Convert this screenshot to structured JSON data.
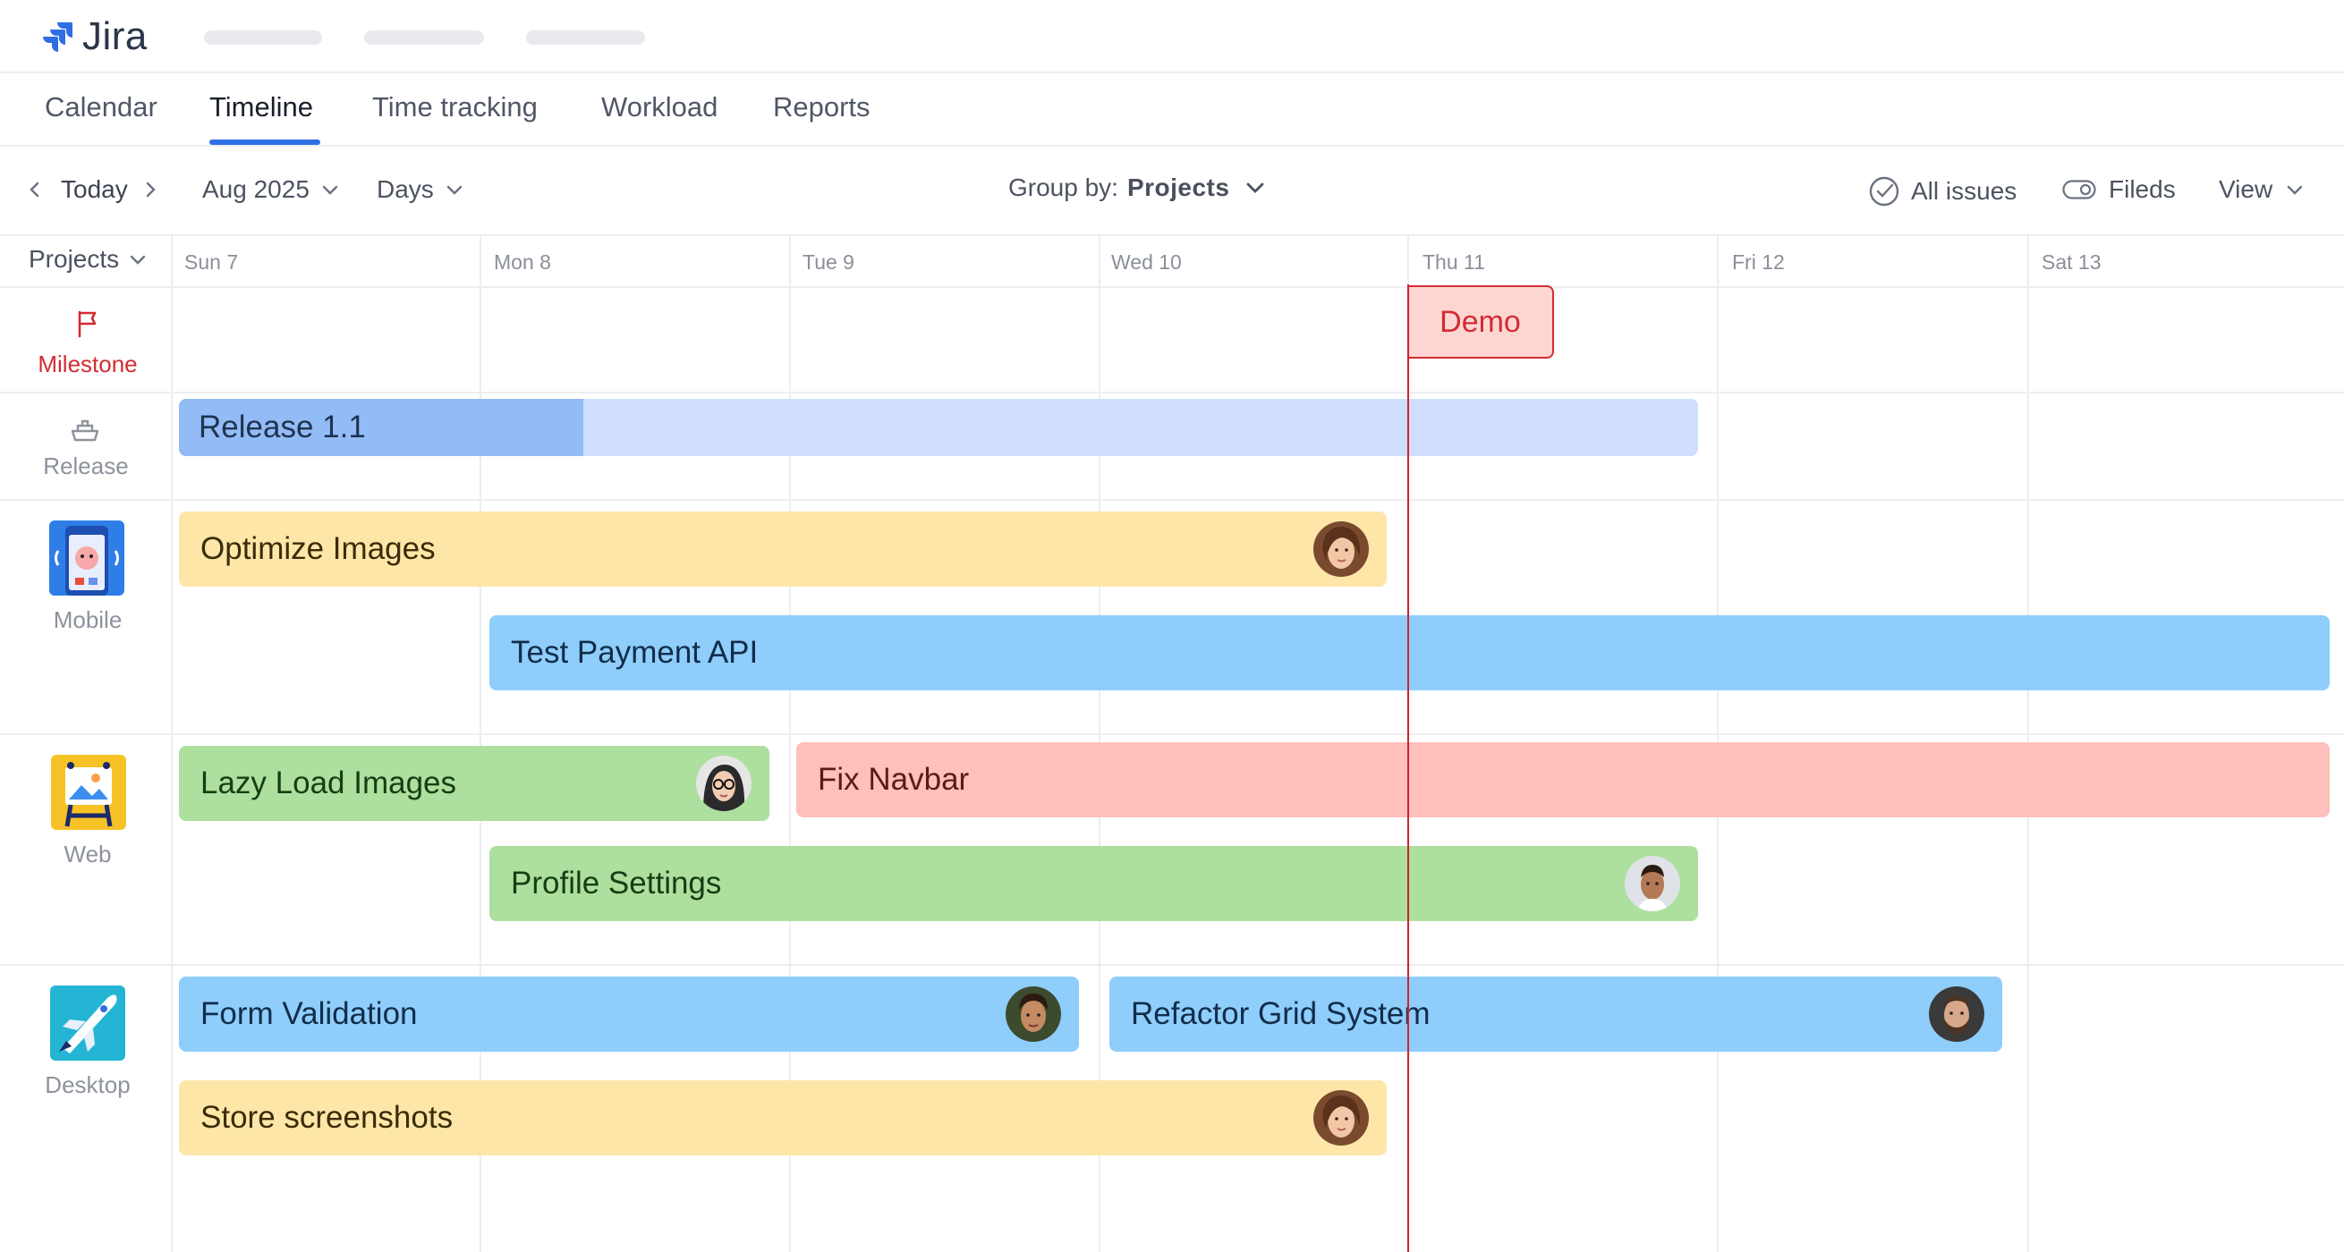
{
  "app": {
    "name": "Jira"
  },
  "tabs": [
    {
      "label": "Calendar",
      "active": false
    },
    {
      "label": "Timeline",
      "active": true
    },
    {
      "label": "Time tracking",
      "active": false
    },
    {
      "label": "Workload",
      "active": false
    },
    {
      "label": "Reports",
      "active": false
    }
  ],
  "toolbar": {
    "today_label": "Today",
    "month_label": "Aug 2025",
    "scale_label": "Days",
    "group_by_prefix": "Group by:",
    "group_by_value": "Projects",
    "all_issues_label": "All issues",
    "fields_label": "Fileds",
    "view_label": "View"
  },
  "grid": {
    "projects_header": "Projects",
    "days": [
      "Sun 7",
      "Mon 8",
      "Tue 9",
      "Wed 10",
      "Thu 11",
      "Fri 12",
      "Sat 13"
    ]
  },
  "rows": {
    "milestone_label": "Milestone",
    "release_label": "Release",
    "mobile_label": "Mobile",
    "web_label": "Web",
    "desktop_label": "Desktop"
  },
  "items": {
    "demo": "Demo",
    "release": "Release 1.1",
    "optimize_images": "Optimize Images",
    "test_payment_api": "Test Payment API",
    "lazy_load_images": "Lazy Load Images",
    "fix_navbar": "Fix Navbar",
    "profile_settings": "Profile Settings",
    "form_validation": "Form Validation",
    "refactor_grid": "Refactor Grid System",
    "store_screenshots": "Store screenshots"
  },
  "colors": {
    "accent": "#2f6fe4",
    "today_line": "#d1222e",
    "milestone": "#d12d32",
    "yellow_bar": "#fde6a8",
    "blue_bar": "#8fcdfb",
    "green_bar": "#addf9e",
    "red_bar": "#fec0bb",
    "release_progress": "#93bcf6",
    "release_track": "#cfdefd"
  }
}
